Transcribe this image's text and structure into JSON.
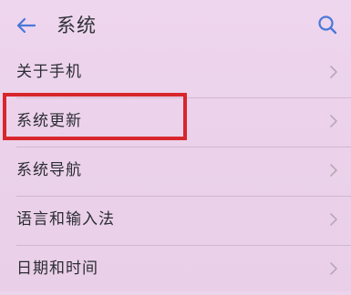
{
  "header": {
    "title": "系统",
    "back_icon": "arrow-left-icon",
    "search_icon": "search-icon"
  },
  "list": {
    "items": [
      {
        "label": "关于手机"
      },
      {
        "label": "系统更新"
      },
      {
        "label": "系统导航"
      },
      {
        "label": "语言和输入法"
      },
      {
        "label": "日期和时间"
      }
    ]
  },
  "colors": {
    "background": "#ecd4ec",
    "accent": "#4a78d8",
    "highlight_border": "#d8262c",
    "chevron": "#b9a8b9"
  }
}
